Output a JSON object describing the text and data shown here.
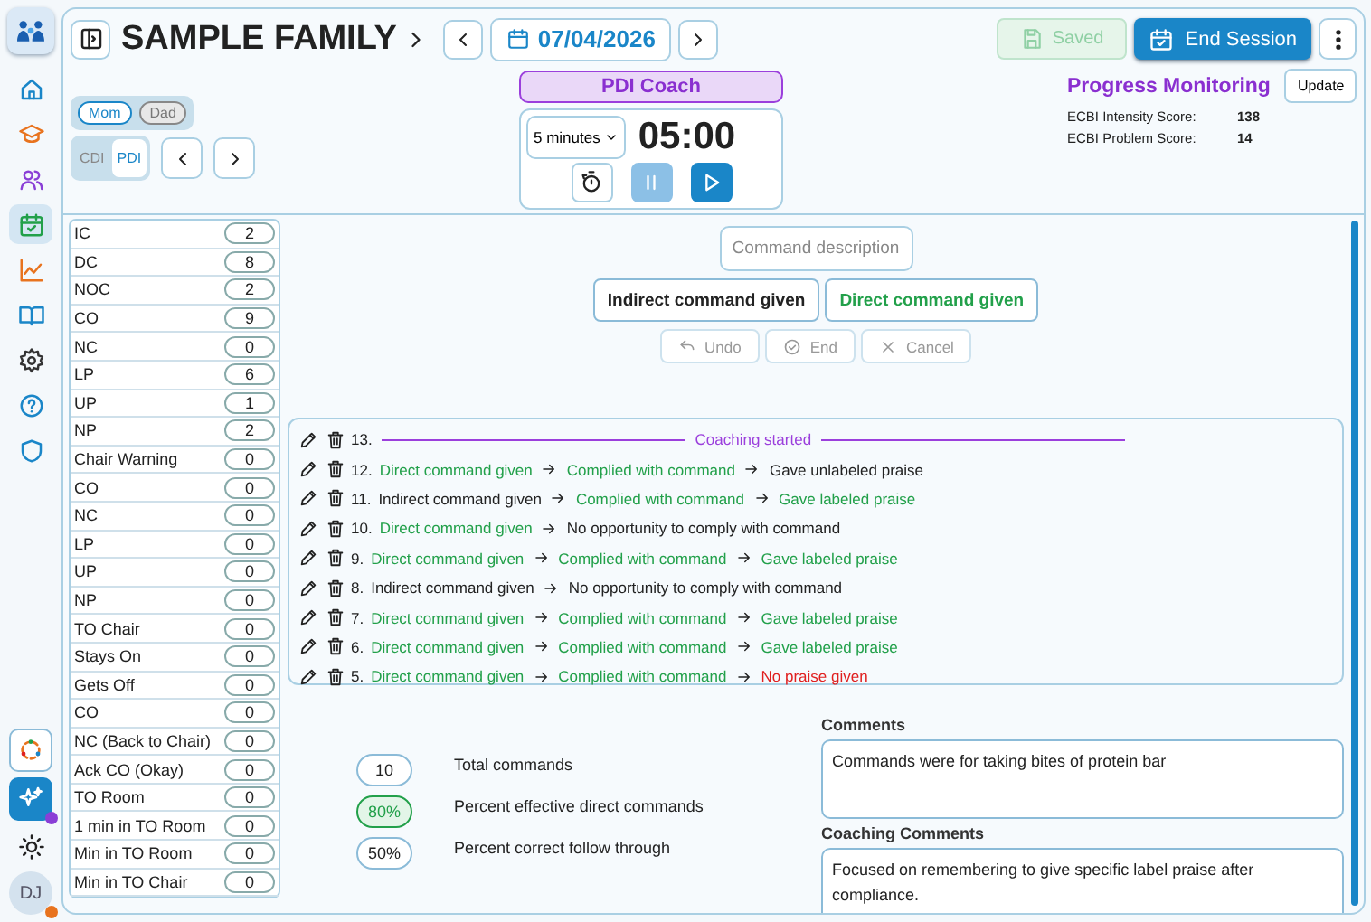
{
  "nav": {
    "items": [
      {
        "kind": "home",
        "selected": false
      },
      {
        "kind": "cap",
        "selected": false
      },
      {
        "kind": "people",
        "selected": false
      },
      {
        "kind": "calendar",
        "selected": true
      },
      {
        "kind": "chart",
        "selected": false
      },
      {
        "kind": "book",
        "selected": false
      },
      {
        "kind": "gear",
        "selected": false
      },
      {
        "kind": "help",
        "selected": false
      },
      {
        "kind": "shield",
        "selected": false
      }
    ],
    "avatar": "DJ"
  },
  "header": {
    "title": "SAMPLE FAMILY",
    "date": "07/04/2026",
    "saved": {
      "label": "Saved",
      "disabled": true
    },
    "end_session": {
      "label": "End Session"
    }
  },
  "parents": [
    {
      "label": "Mom",
      "selected": true
    },
    {
      "label": "Dad",
      "selected": false
    }
  ],
  "modes": [
    {
      "label": "CDI",
      "selected": false
    },
    {
      "label": "PDI",
      "selected": true
    }
  ],
  "coach": {
    "badge": "PDI Coach",
    "duration": "5 minutes",
    "time": "05:00"
  },
  "progress": {
    "title": "Progress Monitoring",
    "update": "Update",
    "scores": [
      {
        "label": "ECBI Intensity Score:",
        "value": "138"
      },
      {
        "label": "ECBI Problem Score:",
        "value": "14"
      }
    ]
  },
  "counters": [
    {
      "label": "IC",
      "count": "2"
    },
    {
      "label": "DC",
      "count": "8"
    },
    {
      "label": "NOC",
      "count": "2"
    },
    {
      "label": "CO",
      "count": "9"
    },
    {
      "label": "NC",
      "count": "0"
    },
    {
      "label": "LP",
      "count": "6"
    },
    {
      "label": "UP",
      "count": "1"
    },
    {
      "label": "NP",
      "count": "2"
    },
    {
      "label": "Chair Warning",
      "count": "0"
    },
    {
      "label": "CO",
      "count": "0"
    },
    {
      "label": "NC",
      "count": "0"
    },
    {
      "label": "LP",
      "count": "0"
    },
    {
      "label": "UP",
      "count": "0"
    },
    {
      "label": "NP",
      "count": "0"
    },
    {
      "label": "TO Chair",
      "count": "0"
    },
    {
      "label": "Stays On",
      "count": "0"
    },
    {
      "label": "Gets Off",
      "count": "0"
    },
    {
      "label": "CO",
      "count": "0"
    },
    {
      "label": "NC (Back to Chair)",
      "count": "0"
    },
    {
      "label": "Ack CO (Okay)",
      "count": "0"
    },
    {
      "label": "TO Room",
      "count": "0"
    },
    {
      "label": "1 min in TO Room",
      "count": "0"
    },
    {
      "label": "Min in TO Room",
      "count": "0"
    },
    {
      "label": "Min in TO Chair",
      "count": "0"
    }
  ],
  "command": {
    "placeholder": "Command description",
    "choices": [
      {
        "label": "Indirect command given",
        "color": "#222222"
      },
      {
        "label": "Direct command given",
        "color": "#22a04a"
      }
    ],
    "actions": [
      {
        "label": "Undo",
        "kind": "undo",
        "disabled": true
      },
      {
        "label": "End",
        "kind": "end",
        "disabled": true
      },
      {
        "label": "Cancel",
        "kind": "cancel",
        "disabled": true
      }
    ]
  },
  "log": [
    {
      "number": "13.",
      "kind": "divider",
      "label": "Coaching started"
    },
    {
      "number": "12.",
      "kind": "chain",
      "steps": [
        {
          "text": "Direct command given",
          "color": "#22a04a"
        },
        {
          "text": "Complied with command",
          "color": "#22a04a"
        },
        {
          "text": "Gave unlabeled praise",
          "color": "#222222"
        }
      ]
    },
    {
      "number": "11.",
      "kind": "chain",
      "steps": [
        {
          "text": "Indirect command given",
          "color": "#222222"
        },
        {
          "text": "Complied with command",
          "color": "#22a04a"
        },
        {
          "text": "Gave labeled praise",
          "color": "#22a04a"
        }
      ]
    },
    {
      "number": "10.",
      "kind": "chain",
      "steps": [
        {
          "text": "Direct command given",
          "color": "#22a04a"
        },
        {
          "text": "No opportunity to comply with command",
          "color": "#222222"
        }
      ]
    },
    {
      "number": "9.",
      "kind": "chain",
      "steps": [
        {
          "text": "Direct command given",
          "color": "#22a04a"
        },
        {
          "text": "Complied with command",
          "color": "#22a04a"
        },
        {
          "text": "Gave labeled praise",
          "color": "#22a04a"
        }
      ]
    },
    {
      "number": "8.",
      "kind": "chain",
      "steps": [
        {
          "text": "Indirect command given",
          "color": "#222222"
        },
        {
          "text": "No opportunity to comply with command",
          "color": "#222222"
        }
      ]
    },
    {
      "number": "7.",
      "kind": "chain",
      "steps": [
        {
          "text": "Direct command given",
          "color": "#22a04a"
        },
        {
          "text": "Complied with command",
          "color": "#22a04a"
        },
        {
          "text": "Gave labeled praise",
          "color": "#22a04a"
        }
      ]
    },
    {
      "number": "6.",
      "kind": "chain",
      "steps": [
        {
          "text": "Direct command given",
          "color": "#22a04a"
        },
        {
          "text": "Complied with command",
          "color": "#22a04a"
        },
        {
          "text": "Gave labeled praise",
          "color": "#22a04a"
        }
      ]
    },
    {
      "number": "5.",
      "kind": "chain",
      "steps": [
        {
          "text": "Direct command given",
          "color": "#22a04a"
        },
        {
          "text": "Complied with command",
          "color": "#22a04a"
        },
        {
          "text": "No praise given",
          "color": "#e02020"
        }
      ]
    }
  ],
  "stats": [
    {
      "value": "10",
      "label": "Total commands",
      "highlight": false
    },
    {
      "value": "80%",
      "label": "Percent effective direct commands",
      "highlight": true
    },
    {
      "value": "50%",
      "label": "Percent correct follow through",
      "highlight": false
    }
  ],
  "comments": [
    {
      "label": "Comments",
      "value": "Commands were for taking bites of protein bar"
    },
    {
      "label": "Coaching Comments",
      "value": "Focused on remembering to give specific label praise after compliance."
    }
  ]
}
